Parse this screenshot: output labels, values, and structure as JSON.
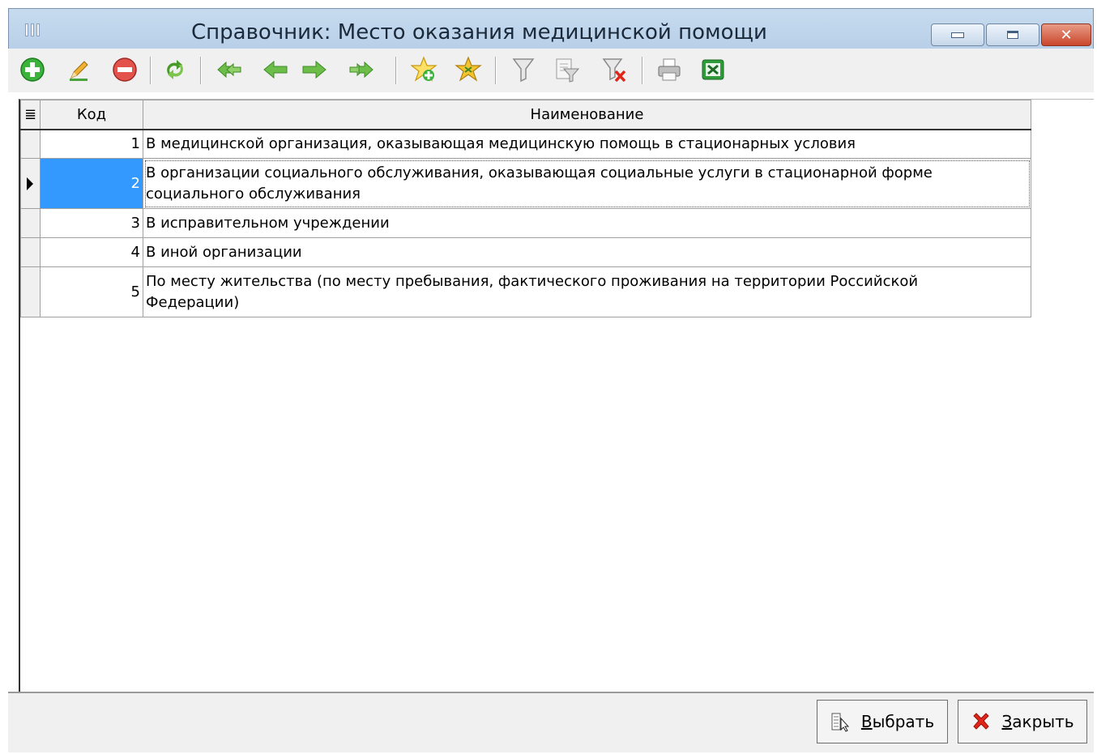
{
  "window": {
    "title": "Справочник: Место оказания медицинской помощи",
    "controls": {
      "minimize": "minimize-icon",
      "maximize": "maximize-icon",
      "close": "✕"
    }
  },
  "toolbar": {
    "icons": [
      "add-icon",
      "edit-icon",
      "delete-icon",
      "refresh-icon",
      "first-record-icon",
      "prev-record-icon",
      "next-record-icon",
      "last-record-icon",
      "add-favorite-icon",
      "favorites-icon",
      "filter-icon",
      "filter-edit-icon",
      "filter-clear-icon",
      "print-icon",
      "excel-export-icon"
    ]
  },
  "grid": {
    "columns": [
      "Код",
      "Наименование"
    ],
    "selected_row": 2,
    "rows": [
      {
        "code": "1",
        "name_lines": [
          "В медицинской организация, оказывающая медицинскую помощь в стационарных условия"
        ]
      },
      {
        "code": "2",
        "name_lines": [
          "В организации социального обслуживания, оказывающая социальные услуги в стационарной форме",
          "социального обслуживания"
        ]
      },
      {
        "code": "3",
        "name_lines": [
          "В исправительном учреждении"
        ]
      },
      {
        "code": "4",
        "name_lines": [
          "В иной организации"
        ]
      },
      {
        "code": "5",
        "name_lines": [
          "По месту жительства (по месту пребывания, фактического проживания на территории Российской",
          "Федерации)"
        ]
      }
    ]
  },
  "buttons": {
    "choose": {
      "underlined_letter": "В",
      "rest": "ыбрать",
      "icon": "select-icon"
    },
    "close": {
      "underlined_letter": "З",
      "rest": "акрыть",
      "icon": "close-x-icon"
    }
  },
  "colors": {
    "selection": "#3399ff",
    "title_bar": "#bcd3ea",
    "close_button": "#c9462c"
  }
}
